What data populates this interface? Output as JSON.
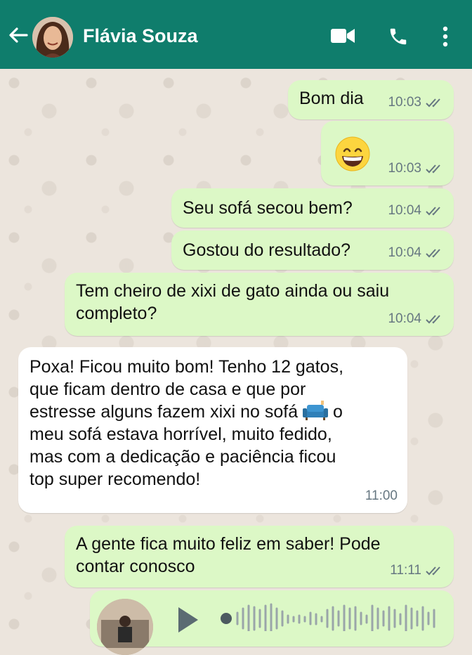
{
  "header": {
    "contact_name": "Flávia Souza",
    "bg_color": "#0f7d6c"
  },
  "messages": [
    {
      "text": "Bom dia",
      "time": "10:03",
      "direction": "out",
      "status": "read"
    },
    {
      "emoji": "grinning-face-emoji",
      "time": "10:03",
      "direction": "out",
      "status": "read"
    },
    {
      "text": "Seu sofá secou bem?",
      "time": "10:04",
      "direction": "out",
      "status": "read"
    },
    {
      "text": "Gostou do resultado?",
      "time": "10:04",
      "direction": "out",
      "status": "read"
    },
    {
      "text": "Tem cheiro de xixi de gato ainda ou saiu\ncompleto?",
      "time": "10:04",
      "direction": "out",
      "status": "read"
    },
    {
      "text_before_emoji": "Poxa! Ficou muito bom! Tenho 12 gatos,\nque ficam dentro de casa e que por\nestresse alguns fazem xixi no sofá ",
      "emoji": "couch-emoji",
      "text_after_emoji": " o\nmeu sofá estava horrível,  muito fedido,\nmas com a dedicação e paciência ficou\ntop super recomendo!",
      "time": "11:00",
      "direction": "in"
    },
    {
      "text": "A gente fica muito feliz em saber! Pode\ncontar conosco",
      "time": "11:11",
      "direction": "out",
      "status": "read"
    },
    {
      "type": "voice-note",
      "direction": "out"
    }
  ],
  "colors": {
    "outgoing_bubble": "#dcf8c6",
    "incoming_bubble": "#ffffff",
    "read_ticks": "#667781",
    "chat_background": "#ece5dd"
  }
}
